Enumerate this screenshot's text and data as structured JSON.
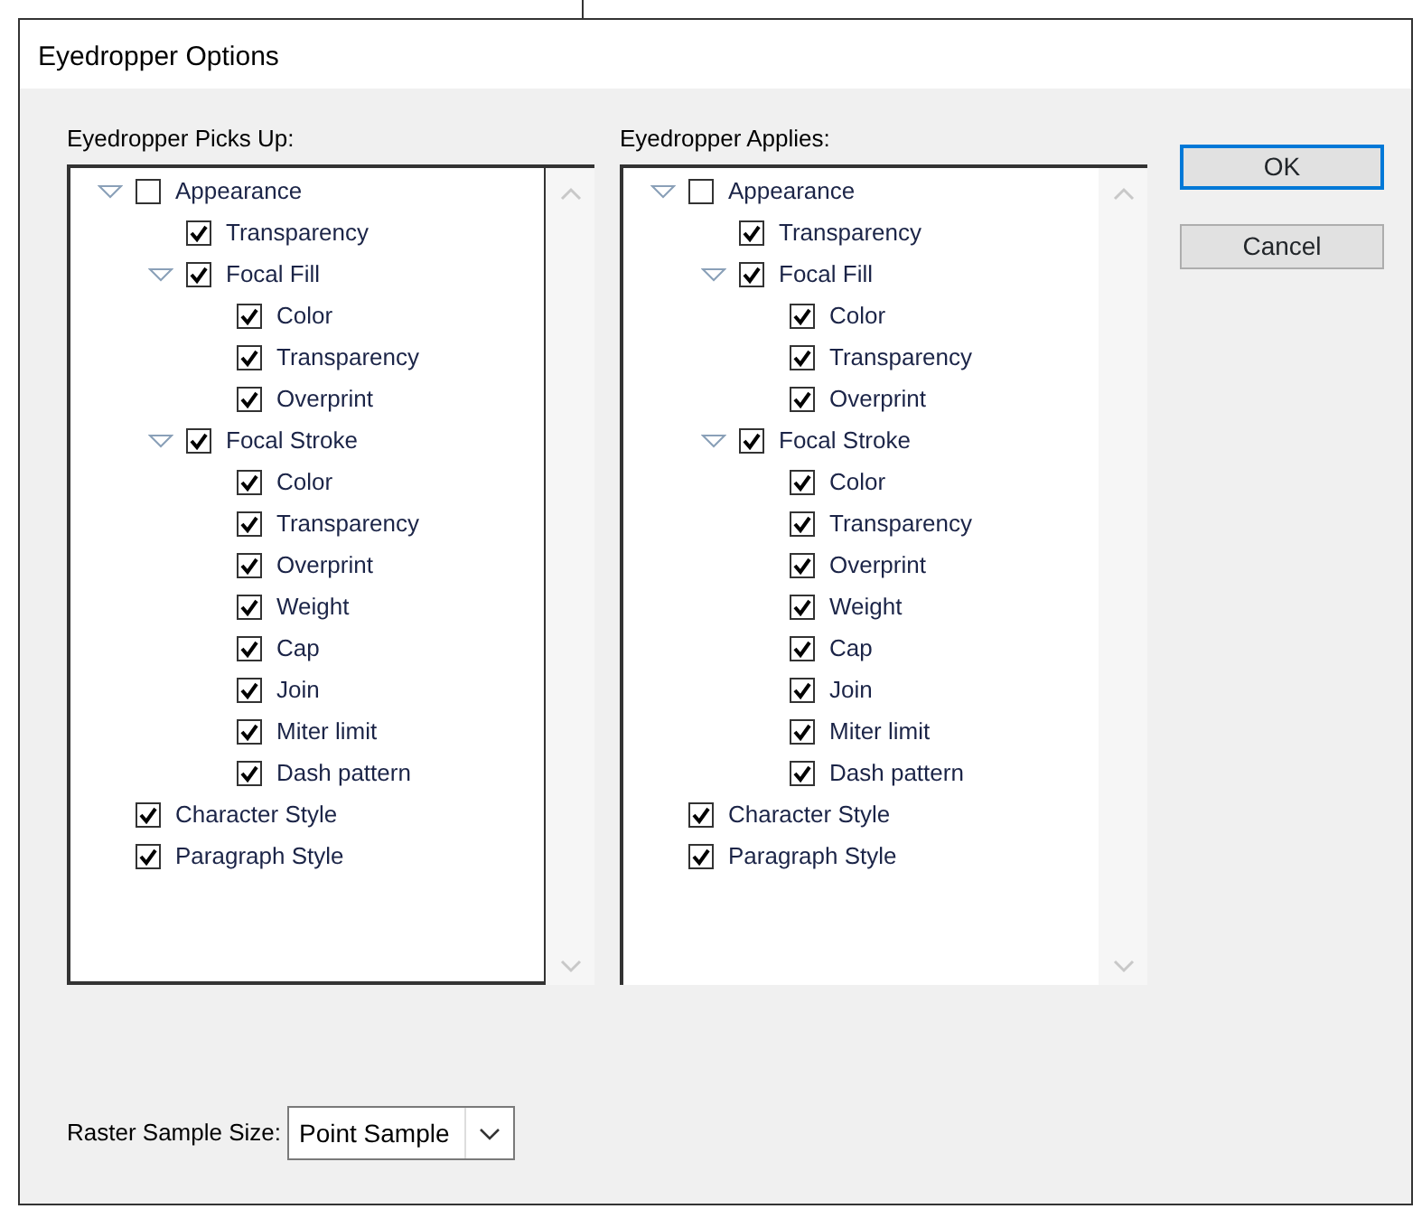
{
  "window": {
    "title": "Eyedropper Options"
  },
  "panels": [
    {
      "label": "Eyedropper Picks Up:",
      "tree": [
        {
          "label": "Appearance",
          "checked": false,
          "expanded": true,
          "children": [
            {
              "label": "Transparency",
              "checked": true
            },
            {
              "label": "Focal Fill",
              "checked": true,
              "expanded": true,
              "children": [
                {
                  "label": "Color",
                  "checked": true
                },
                {
                  "label": "Transparency",
                  "checked": true
                },
                {
                  "label": "Overprint",
                  "checked": true
                }
              ]
            },
            {
              "label": "Focal Stroke",
              "checked": true,
              "expanded": true,
              "children": [
                {
                  "label": "Color",
                  "checked": true
                },
                {
                  "label": "Transparency",
                  "checked": true
                },
                {
                  "label": "Overprint",
                  "checked": true
                },
                {
                  "label": "Weight",
                  "checked": true
                },
                {
                  "label": "Cap",
                  "checked": true
                },
                {
                  "label": "Join",
                  "checked": true
                },
                {
                  "label": "Miter limit",
                  "checked": true
                },
                {
                  "label": "Dash pattern",
                  "checked": true
                }
              ]
            }
          ]
        },
        {
          "label": "Character Style",
          "checked": true
        },
        {
          "label": "Paragraph Style",
          "checked": true
        }
      ]
    },
    {
      "label": "Eyedropper Applies:",
      "tree": [
        {
          "label": "Appearance",
          "checked": false,
          "expanded": true,
          "children": [
            {
              "label": "Transparency",
              "checked": true
            },
            {
              "label": "Focal Fill",
              "checked": true,
              "expanded": true,
              "children": [
                {
                  "label": "Color",
                  "checked": true
                },
                {
                  "label": "Transparency",
                  "checked": true
                },
                {
                  "label": "Overprint",
                  "checked": true
                }
              ]
            },
            {
              "label": "Focal Stroke",
              "checked": true,
              "expanded": true,
              "children": [
                {
                  "label": "Color",
                  "checked": true
                },
                {
                  "label": "Transparency",
                  "checked": true
                },
                {
                  "label": "Overprint",
                  "checked": true
                },
                {
                  "label": "Weight",
                  "checked": true
                },
                {
                  "label": "Cap",
                  "checked": true
                },
                {
                  "label": "Join",
                  "checked": true
                },
                {
                  "label": "Miter limit",
                  "checked": true
                },
                {
                  "label": "Dash pattern",
                  "checked": true
                }
              ]
            }
          ]
        },
        {
          "label": "Character Style",
          "checked": true
        },
        {
          "label": "Paragraph Style",
          "checked": true
        }
      ]
    }
  ],
  "buttons": [
    {
      "label": "OK",
      "default": true
    },
    {
      "label": "Cancel",
      "default": false
    }
  ],
  "raster_sample_size": {
    "label": "Raster Sample Size:",
    "value": "Point Sample"
  }
}
